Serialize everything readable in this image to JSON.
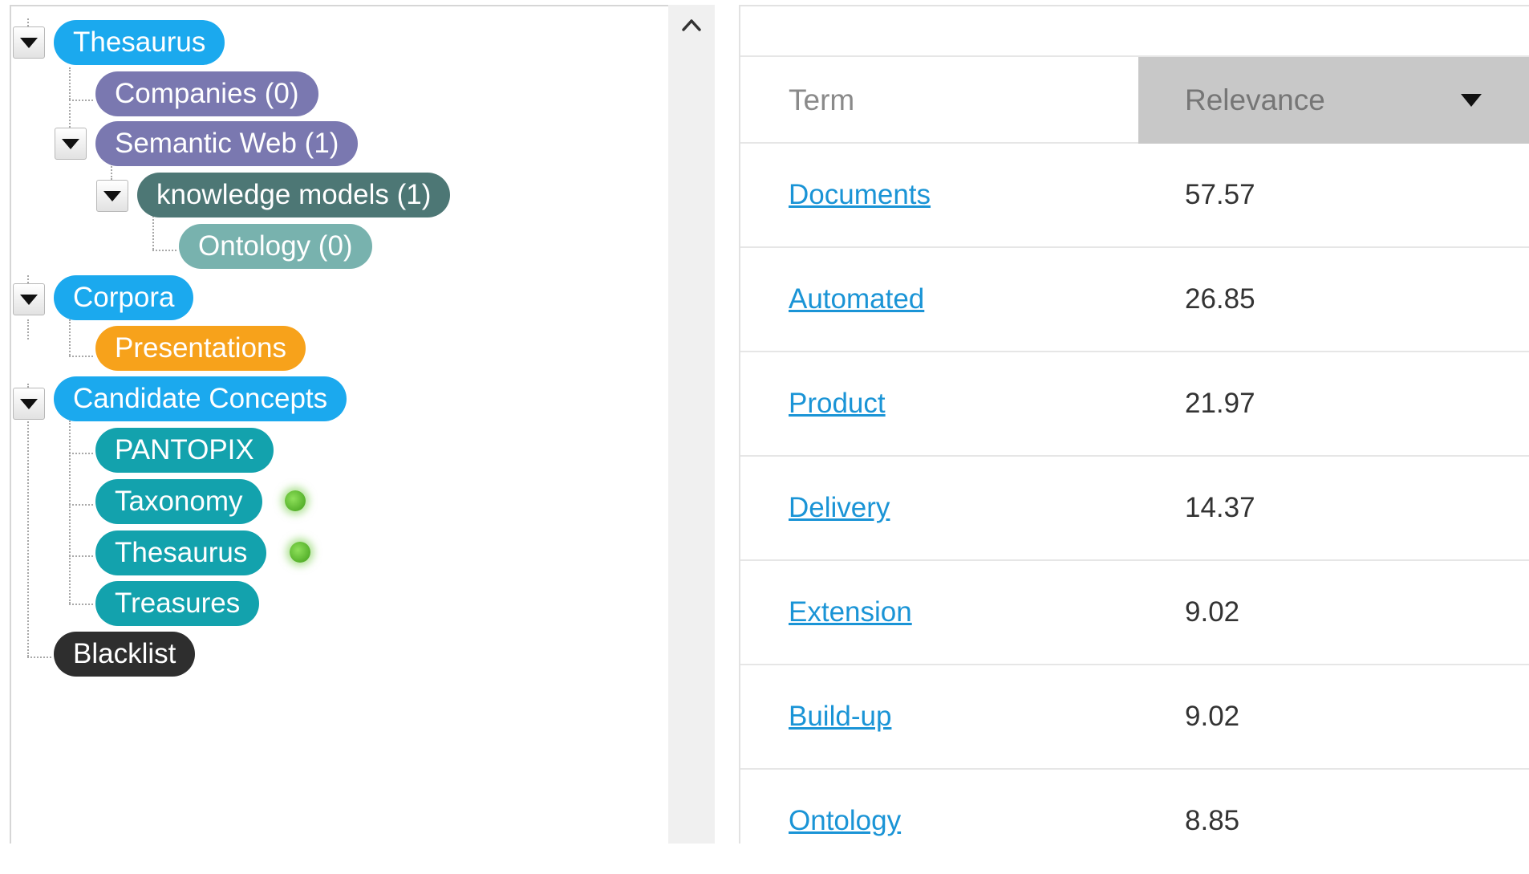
{
  "tree": {
    "nodes": [
      {
        "label": "Thesaurus",
        "color": "#1ba9ee",
        "text_color": "#ffffff",
        "expanded": true
      },
      {
        "label": "Companies (0)",
        "color": "#7a78b0",
        "text_color": "#ffffff"
      },
      {
        "label": "Semantic Web (1)",
        "color": "#7a78b0",
        "text_color": "#ffffff",
        "expanded": true
      },
      {
        "label": "knowledge models (1)",
        "color": "#4d7775",
        "text_color": "#ffffff",
        "expanded": true
      },
      {
        "label": "Ontology (0)",
        "color": "#78b2ae",
        "text_color": "#ffffff"
      },
      {
        "label": "Corpora",
        "color": "#1ba9ee",
        "text_color": "#ffffff",
        "expanded": true
      },
      {
        "label": "Presentations",
        "color": "#f7a21b",
        "text_color": "#ffffff"
      },
      {
        "label": "Candidate Concepts",
        "color": "#1ba9ee",
        "text_color": "#ffffff",
        "expanded": true
      },
      {
        "label": "PANTOPIX",
        "color": "#13a2ad",
        "text_color": "#ffffff"
      },
      {
        "label": "Taxonomy",
        "color": "#13a2ad",
        "text_color": "#ffffff",
        "status": "green-dot"
      },
      {
        "label": "Thesaurus",
        "color": "#13a2ad",
        "text_color": "#ffffff",
        "status": "green-dot"
      },
      {
        "label": "Treasures",
        "color": "#13a2ad",
        "text_color": "#ffffff"
      },
      {
        "label": "Blacklist",
        "color": "#2e2e2e",
        "text_color": "#ffffff"
      }
    ]
  },
  "table": {
    "columns": {
      "term": "Term",
      "relevance": "Relevance"
    },
    "sort_icon": "caret-down-icon",
    "rows": [
      {
        "term": "Documents",
        "relevance": "57.57"
      },
      {
        "term": "Automated",
        "relevance": "26.85"
      },
      {
        "term": "Product",
        "relevance": "21.97"
      },
      {
        "term": "Delivery",
        "relevance": "14.37"
      },
      {
        "term": "Extension",
        "relevance": "9.02"
      },
      {
        "term": "Build-up",
        "relevance": "9.02"
      },
      {
        "term": "Ontology",
        "relevance": "8.85"
      }
    ]
  },
  "scrollbar": {
    "up_icon": "chevron-up-icon"
  }
}
